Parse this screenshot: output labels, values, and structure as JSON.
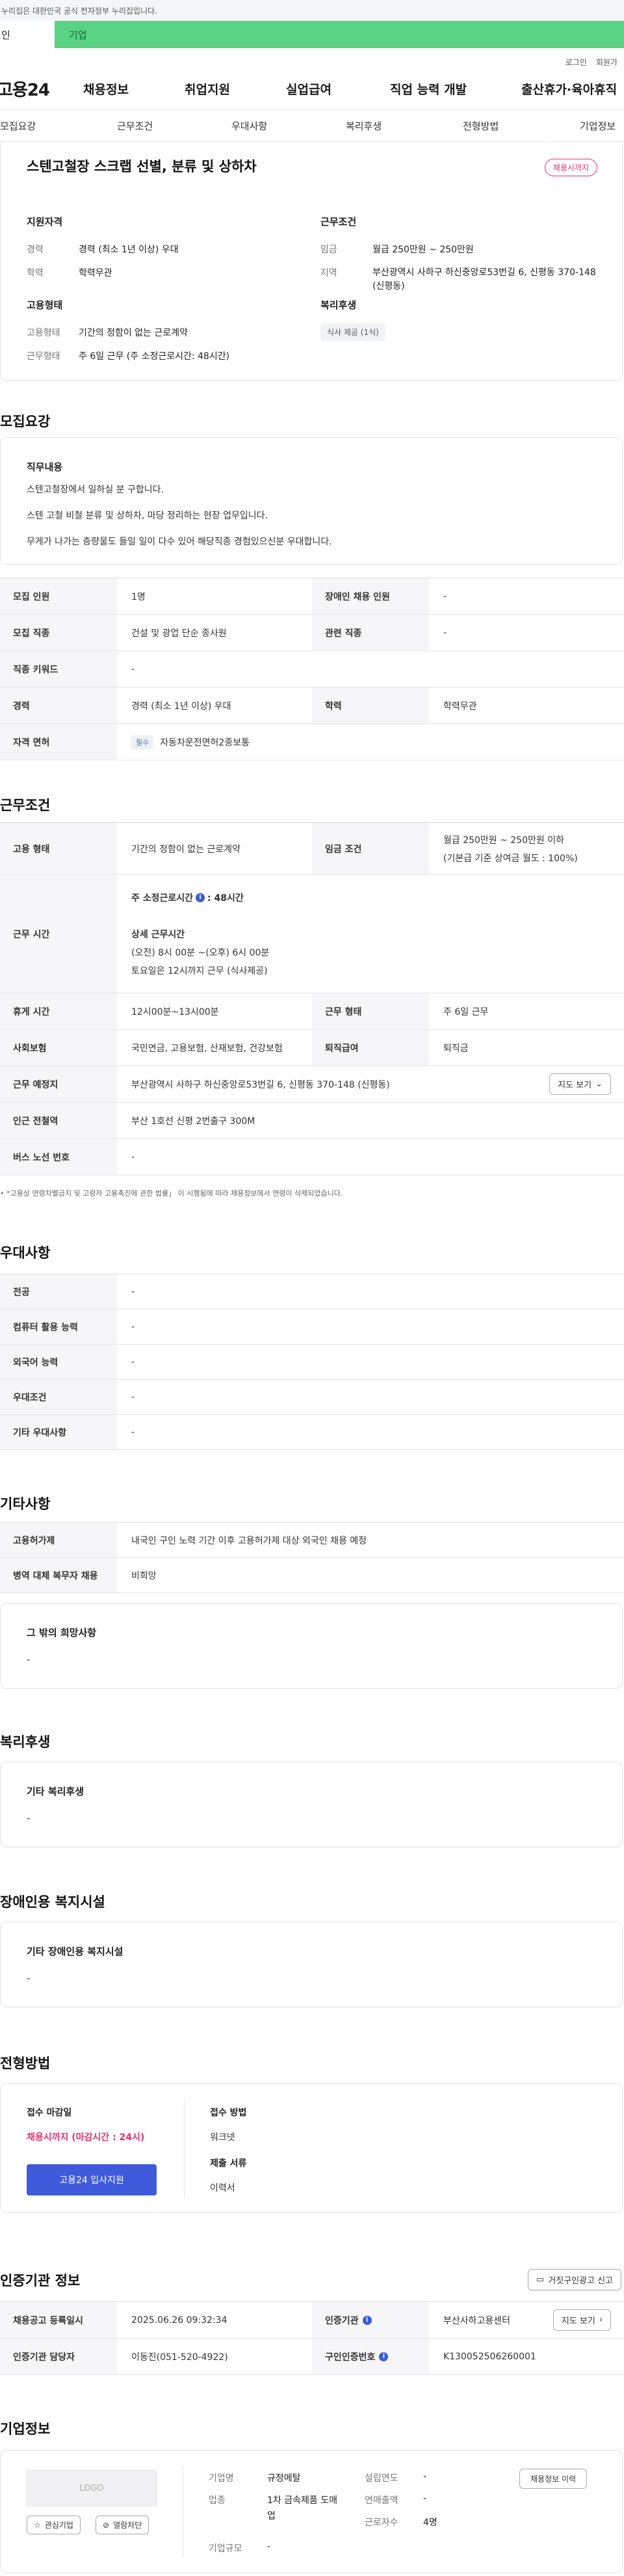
{
  "gov_banner": "누리집은 대한민국 공식 전자정부 누리집입니다.",
  "member_tabs": [
    "인",
    "기업"
  ],
  "top_links": [
    "로그인",
    "회원가"
  ],
  "logo": "고용24",
  "main_menu": [
    "채용정보",
    "취업지원",
    "실업급여",
    "직업 능력 개발",
    "출산휴가·육아휴직"
  ],
  "sub_nav": [
    "모집요강",
    "근무조건",
    "우대사항",
    "복리후생",
    "전형방법",
    "기업정보"
  ],
  "job": {
    "title": "스텐고철장 스크랩 선별, 분류 및 상하차",
    "status_badge": "채용시까지",
    "qual": {
      "heading": "지원자격",
      "rows": [
        {
          "k": "경력",
          "v": "경력 (최소 1년 이상) 우대"
        },
        {
          "k": "학력",
          "v": "학력무관"
        }
      ]
    },
    "emp": {
      "heading": "고용형태",
      "rows": [
        {
          "k": "고용형태",
          "v": "기간의 정함이 없는 근로계약"
        },
        {
          "k": "근무형태",
          "v": "주 6일 근무 (주 소정근로시간: 48시간)"
        }
      ]
    },
    "cond": {
      "heading": "근무조건",
      "rows": [
        {
          "k": "임금",
          "v": "월급 250만원 ~ 250만원"
        },
        {
          "k": "지역",
          "v": "부산광역시 사하구 하신중앙로53번길 6, 신평동 370-148 (신평동)"
        }
      ]
    },
    "welfare": {
      "heading": "복리후생",
      "tag": "식사 제공 (1식)"
    }
  },
  "recruit": {
    "title": "모집요강",
    "duty_heading": "직무내용",
    "duty_lines": [
      "스텐고철장에서 일하실 분 구합니다.",
      "스텐 고철 비철 분류 및 상하차, 마당 정리하는 현장 업무입니다.",
      "무게가 나가는 층량물도 들일 일이 다수 있어 해당직종 경험있으신분 우대합니다."
    ],
    "table": [
      [
        {
          "k": "모집 인원",
          "v": "1명"
        },
        {
          "k": "장애인 채용 인원",
          "v": "-"
        }
      ],
      [
        {
          "k": "모집 직종",
          "v": "건설 및 광업 단순 종사원"
        },
        {
          "k": "관련 직종",
          "v": "-"
        }
      ],
      [
        {
          "k": "직종 키워드",
          "v": "-"
        }
      ],
      [
        {
          "k": "경력",
          "v": "경력 (최소 1년 이상) 우대"
        },
        {
          "k": "학력",
          "v": "학력무관"
        }
      ]
    ],
    "license": {
      "k": "자격 면허",
      "badge": "필수",
      "v": "자동차운전면허2종보통"
    }
  },
  "work": {
    "title": "근무조건",
    "emp_k": "고용 형태",
    "emp_v": "기간의 정함이 없는 근로계약",
    "wage_k": "임금 조건",
    "wage_v1": "월급 250만원 ~ 250만원 이하",
    "wage_v2": "(기본급 기준 상여금 월도 : 100%)",
    "hours_k": "근무 시간",
    "hours_main_label": "주 소정근로시간",
    "hours_main_value": ": 48시간",
    "hours_detail_label": "상세 근무시간",
    "hours_detail_1": "(오전) 8시 00분 ~(오후) 6시 00분",
    "hours_detail_2": "토요일은 12시까지 근무 (식사제공)",
    "rest_k": "휴게 시간",
    "rest_v": "12시00분~13시00분",
    "form_k": "근무 형태",
    "form_v": "주 6일 근무",
    "ins_k": "사회보험",
    "ins_v": "국민연금, 고용보험, 산재보험, 건강보험",
    "sev_k": "퇴직급여",
    "sev_v": "퇴직금",
    "place_k": "근무 예정지",
    "place_v": "부산광역시 사하구 하신중앙로53번길 6, 신평동 370-148 (신평동)",
    "map_btn": "지도 보기",
    "station_k": "인근 전철역",
    "station_v": "부산 1호선 신평 2번출구 300M",
    "bus_k": "버스 노선 번호",
    "bus_v": "-",
    "note": "*고용상 연령차별금지 및 고령자 고용촉진에 관한 법률」 이 시행됨에 따라 채용정보에서 연령이 삭제되었습니다."
  },
  "pref": {
    "title": "우대사항",
    "rows": [
      {
        "k": "전공",
        "v": "-"
      },
      {
        "k": "컴퓨터 활용 능력",
        "v": "-"
      },
      {
        "k": "외국어 능력",
        "v": "-"
      },
      {
        "k": "우대조건",
        "v": "-"
      },
      {
        "k": "기타 우대사항",
        "v": "-"
      }
    ]
  },
  "etc": {
    "title": "기타사항",
    "rows": [
      {
        "k": "고용허가제",
        "v": "내국인 구인 노력 기간 이후 고용허가제 대상 외국인 채용 예정"
      },
      {
        "k": "병역 대체 복무자 채용",
        "v": "비희망"
      }
    ],
    "other_h": "그 밖의 희망사항",
    "other_v": "-"
  },
  "benefit": {
    "title": "복리후생",
    "h": "기타 복리후생",
    "v": "-"
  },
  "disabled": {
    "title": "장애인용 복지시설",
    "h": "기타 장애인용 복지시설",
    "v": "-"
  },
  "selection": {
    "title": "전형방법",
    "deadline_h": "접수 마감일",
    "deadline_v": "채용시까지 (마감시간 : 24시)",
    "apply_btn": "고용24 입사지원",
    "method_h": "접수 방법",
    "method_v": "워크넷",
    "docs_h": "제출 서류",
    "docs_v": "이력서"
  },
  "agency": {
    "title": "인증기관 정보",
    "report_btn": "거짓구인광고 신고",
    "reg_k": "채용공고 등록일시",
    "reg_v": "2025.06.26 09:32:34",
    "inst_k": "인증기관",
    "inst_v": "부산사하고용센터",
    "inst_btn": "지도 보기",
    "mgr_k": "인증기관 담당자",
    "mgr_v": "이동진(051-520-4922)",
    "num_k": "구인인증번호",
    "num_v": "K130052506260001"
  },
  "company": {
    "title": "기업정보",
    "logo_text": "LOGO",
    "interest_btn": "관심기업",
    "block_btn": "열람차단",
    "name_k": "기업명",
    "name_v": "규정메탈",
    "biz_k": "업종",
    "biz_v": "1차 금속제품 도매업",
    "size_k": "기업규모",
    "size_v": "-",
    "year_k": "설립연도",
    "year_v": "-",
    "rev_k": "연매출액",
    "rev_v": "-",
    "emp_k": "근로자수",
    "emp_v": "4명",
    "hist_btn": "채용정보 이력"
  }
}
